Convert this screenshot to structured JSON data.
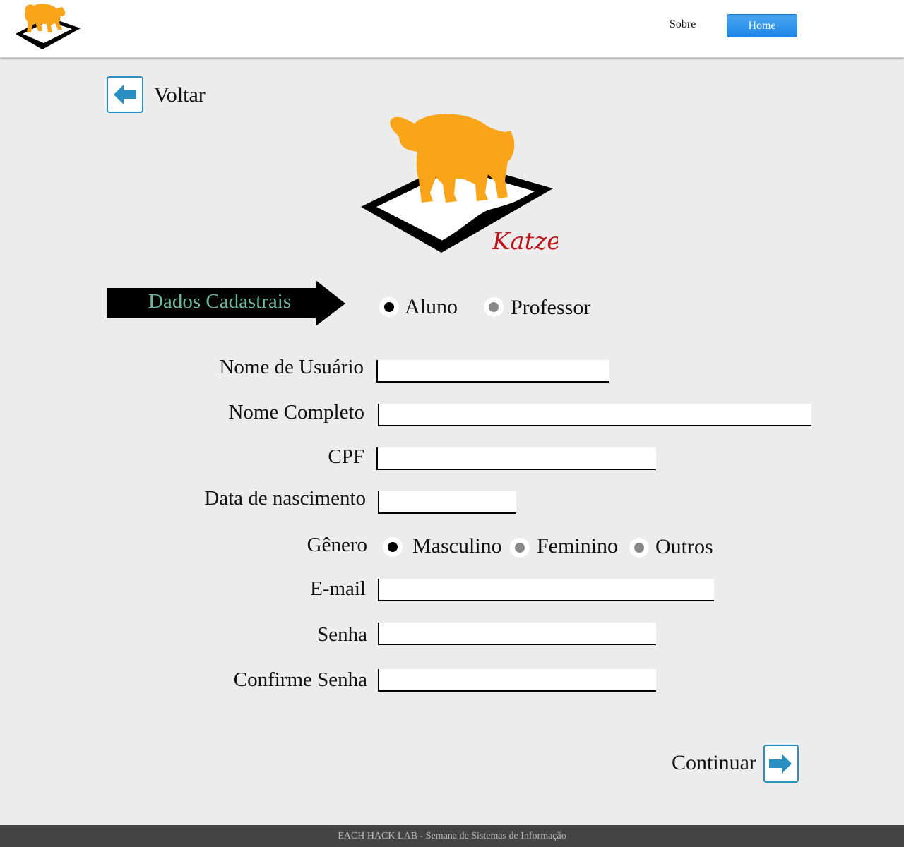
{
  "header": {
    "nav_sobre": "Sobre",
    "nav_home": "Home"
  },
  "back": {
    "label": "Voltar"
  },
  "logo": {
    "text": "Katze"
  },
  "banner": {
    "title": "Dados Cadastrais"
  },
  "user_type": {
    "options": [
      "Aluno",
      "Professor"
    ],
    "selected": "Aluno"
  },
  "form": {
    "username_label": "Nome de Usuário",
    "fullname_label": "Nome Completo",
    "cpf_label": "CPF",
    "birthdate_label": "Data de nascimento",
    "gender_label": "Gênero",
    "gender_options": [
      "Masculino",
      "Feminino",
      "Outros"
    ],
    "gender_selected": "Masculino",
    "email_label": "E-mail",
    "password_label": "Senha",
    "confirm_password_label": "Confirme Senha",
    "username_value": "",
    "fullname_value": "",
    "cpf_value": "",
    "birthdate_value": "",
    "email_value": "",
    "password_value": "",
    "confirm_password_value": ""
  },
  "continue": {
    "label": "Continuar"
  },
  "footer": {
    "text": "EACH HACK LAB - Semana de Sistemas de Informação"
  },
  "colors": {
    "accent_blue": "#2b8fc4",
    "home_button": "#2a8ee8",
    "banner_text": "#6ab8a0",
    "cat_orange": "#f9a419",
    "logo_red": "#c0141c",
    "footer_bg": "#444444"
  }
}
